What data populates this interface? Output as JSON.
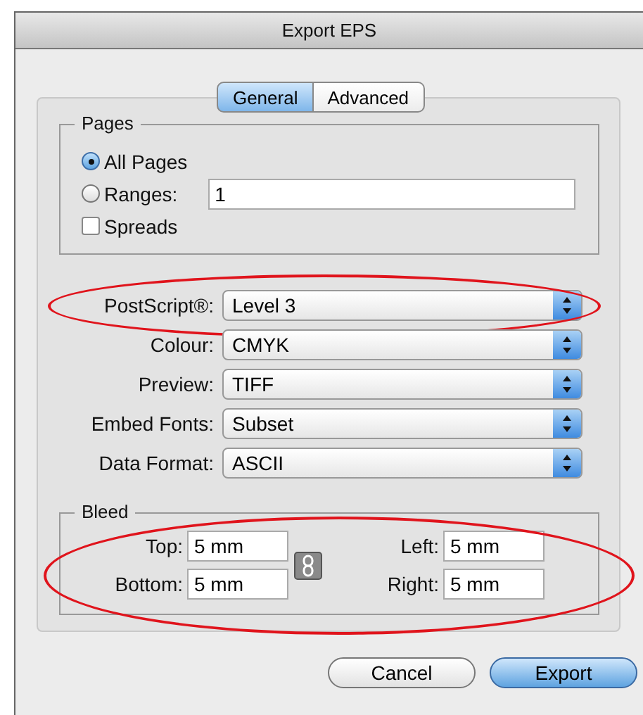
{
  "window": {
    "title": "Export EPS"
  },
  "tabs": [
    {
      "label": "General",
      "selected": true
    },
    {
      "label": "Advanced",
      "selected": false
    }
  ],
  "pages": {
    "title": "Pages",
    "options": [
      {
        "label": "All Pages",
        "selected": true
      },
      {
        "label": "Ranges:",
        "selected": false
      }
    ],
    "ranges_value": "1",
    "spreads": {
      "label": "Spreads",
      "checked": false
    }
  },
  "settings": [
    {
      "label": "PostScript®:",
      "value": "Level 3",
      "circled": true
    },
    {
      "label": "Colour:",
      "value": "CMYK",
      "circled": false
    },
    {
      "label": "Preview:",
      "value": "TIFF",
      "circled": false
    },
    {
      "label": "Embed Fonts:",
      "value": "Subset",
      "circled": false
    },
    {
      "label": "Data Format:",
      "value": "ASCII",
      "circled": false
    }
  ],
  "bleed": {
    "title": "Bleed",
    "circled": true,
    "fields": [
      {
        "label": "Top:",
        "value": "5 mm"
      },
      {
        "label": "Left:",
        "value": "5 mm"
      },
      {
        "label": "Bottom:",
        "value": "5 mm"
      },
      {
        "label": "Right:",
        "value": "5 mm"
      }
    ]
  },
  "buttons": [
    {
      "label": "Cancel",
      "default": false
    },
    {
      "label": "Export",
      "default": true
    }
  ]
}
